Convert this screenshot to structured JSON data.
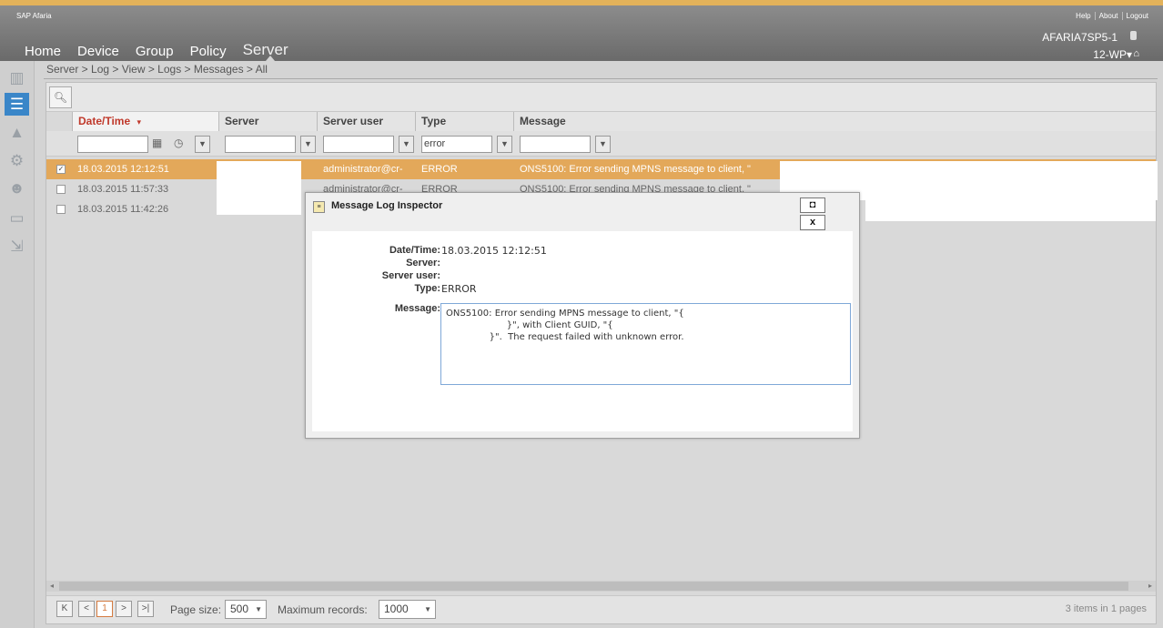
{
  "header": {
    "brand": "SAP Afaria",
    "links": [
      "Help",
      "About",
      "Logout"
    ],
    "nav": [
      "Home",
      "Device",
      "Group",
      "Policy",
      "Server"
    ],
    "server_name": "AFARIA7SP5-1",
    "user": "12-WP▾"
  },
  "breadcrumb": "Server > Log > View > Logs > Messages > All",
  "grid": {
    "columns": [
      "Date/Time",
      "Server",
      "Server user",
      "Type",
      "Message"
    ],
    "sort_indicator": "▾",
    "filters": {
      "type": "error"
    },
    "rows": [
      {
        "checked": true,
        "datetime": "18.03.2015 12:12:51",
        "server": "",
        "server_user": "administrator@cr-",
        "type": "ERROR",
        "message": "ONS5100: Error sending MPNS message to client, \""
      },
      {
        "checked": false,
        "datetime": "18.03.2015 11:57:33",
        "server": "",
        "server_user": "administrator@cr-",
        "type": "ERROR",
        "message": "ONS5100: Error sending MPNS message to client, \""
      },
      {
        "checked": false,
        "datetime": "18.03.2015 11:42:26",
        "server": "",
        "server_user": "",
        "type": "",
        "message": ""
      }
    ]
  },
  "pager": {
    "page": "1",
    "page_size_label": "Page size:",
    "page_size": "500",
    "max_records_label": "Maximum records:",
    "max_records": "1000",
    "info": "3 items in 1 pages"
  },
  "dialog": {
    "title": "Message Log Inspector",
    "labels": {
      "datetime": "Date/Time:",
      "server": "Server:",
      "server_user": "Server user:",
      "type": "Type:",
      "message": "Message:"
    },
    "values": {
      "datetime": "18.03.2015 12:12:51",
      "server": "",
      "server_user": "",
      "type": "ERROR",
      "message": "ONS5100: Error sending MPNS message to client, \"{\n                     }\", with Client GUID, \"{\n               }\".  The request failed with unknown error."
    },
    "maximize_glyph": "◘",
    "close_glyph": "x"
  },
  "colors": {
    "accent": "#e3b25a",
    "selected_row": "#e3a85a",
    "sort_header": "#c0392b",
    "nav_active": "#3a86c8"
  },
  "icons": [
    "chart-icon",
    "list-icon",
    "alert-icon",
    "gear-icon",
    "users-icon",
    "chat-icon",
    "export-icon"
  ]
}
